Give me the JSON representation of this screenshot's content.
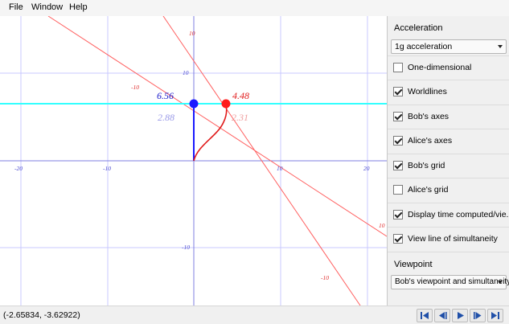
{
  "menu": [
    "File",
    "Window",
    "Help"
  ],
  "plot": {
    "axis_ticks": {
      "x_left_20": "-20",
      "x_left_10": "-10",
      "x_right_10": "10",
      "x_right_20": "20",
      "y_up_10": "10",
      "y_down_10": "-10"
    },
    "alice_ticks": {
      "t_pos_10": "10",
      "t_neg_10": "-10",
      "x_neg_10": "-10",
      "x_pos_10": "10"
    },
    "bob_time": "6.56",
    "bob_time_secondary": "2.88",
    "alice_time": "4.48",
    "alice_time_secondary": "2.31",
    "colors": {
      "bob": "#1a1aff",
      "alice": "#ff1a1a",
      "simultaneity": "#33ffff",
      "grid": "#c8c8ff",
      "bob_axes": "#8888dd",
      "alice_axes": "#ff7070"
    }
  },
  "sidebar": {
    "acceleration_label": "Acceleration",
    "acceleration_value": "1g acceleration",
    "options": [
      {
        "label": "One-dimensional",
        "checked": false
      },
      {
        "label": "Worldlines",
        "checked": true
      },
      {
        "label": "Bob's axes",
        "checked": true
      },
      {
        "label": "Alice's axes",
        "checked": true
      },
      {
        "label": "Bob's grid",
        "checked": true
      },
      {
        "label": "Alice's grid",
        "checked": false
      },
      {
        "label": "Display time computed/vie...",
        "checked": true
      },
      {
        "label": "View line of simultaneity",
        "checked": true
      }
    ],
    "viewpoint_label": "Viewpoint",
    "viewpoint_value": "Bob's viewpoint and simultaneity"
  },
  "status": {
    "coords": "(-2.65834, -3.62922)"
  },
  "nav_buttons": [
    "skip-to-start",
    "step-back",
    "play",
    "step-forward",
    "skip-to-end"
  ]
}
